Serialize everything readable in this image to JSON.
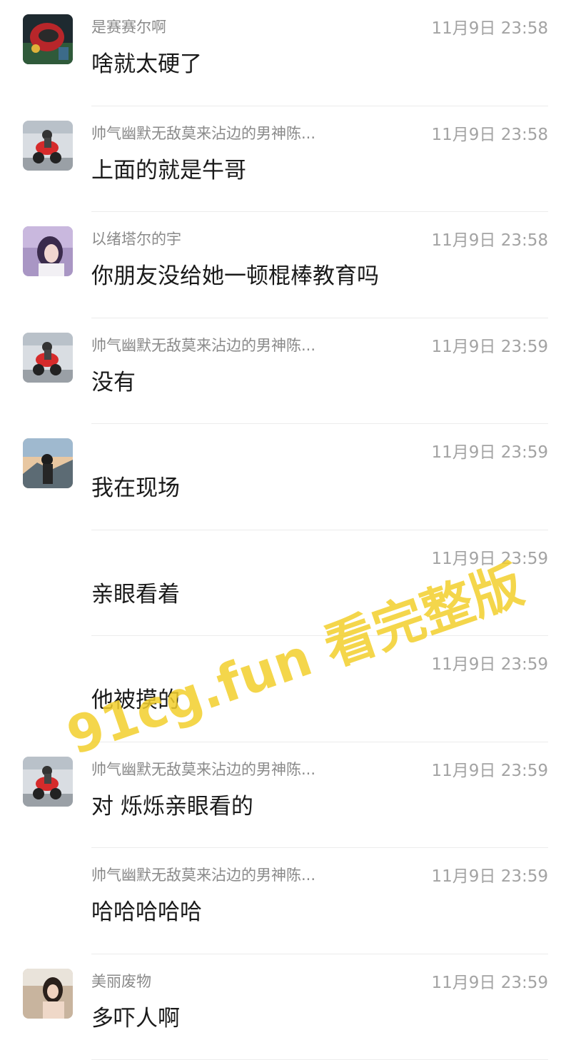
{
  "messages": [
    {
      "sender": "是赛赛尔啊",
      "time": "11月9日 23:58",
      "text": "啥就太硬了",
      "avatar": "helmet-avatar"
    },
    {
      "sender": "帅气幽默无敌莫来沾边的男神陈...",
      "time": "11月9日 23:58",
      "text": "上面的就是牛哥",
      "avatar": "motorcycle-avatar"
    },
    {
      "sender": "以绪塔尔的宇",
      "time": "11月9日 23:58",
      "text": "你朋友没给她一顿棍棒教育吗",
      "avatar": "anime-girl-avatar"
    },
    {
      "sender": "帅气幽默无敌莫来沾边的男神陈...",
      "time": "11月9日 23:59",
      "text": "没有",
      "avatar": "motorcycle-avatar"
    },
    {
      "sender": "",
      "time": "11月9日 23:59",
      "text": "我在现场",
      "avatar": "mountain-rider-avatar"
    },
    {
      "sender": "",
      "time": "11月9日 23:59",
      "text": "亲眼看着",
      "avatar": ""
    },
    {
      "sender": "",
      "time": "11月9日 23:59",
      "text": "他被摸的",
      "avatar": ""
    },
    {
      "sender": "帅气幽默无敌莫来沾边的男神陈...",
      "time": "11月9日 23:59",
      "text": "对 烁烁亲眼看的",
      "avatar": "motorcycle-avatar"
    },
    {
      "sender": "帅气幽默无敌莫来沾边的男神陈...",
      "time": "11月9日 23:59",
      "text": "哈哈哈哈哈",
      "avatar": ""
    },
    {
      "sender": "美丽废物",
      "time": "11月9日 23:59",
      "text": "多吓人啊",
      "avatar": "girl-photo-avatar"
    }
  ],
  "watermark": "91cg.fun 看完整版",
  "colors": {
    "sender": "#8a8a8a",
    "time": "#a3a3a3",
    "text": "#1a1a1a",
    "divider": "#ececec",
    "watermark": "#f3cf2c"
  }
}
